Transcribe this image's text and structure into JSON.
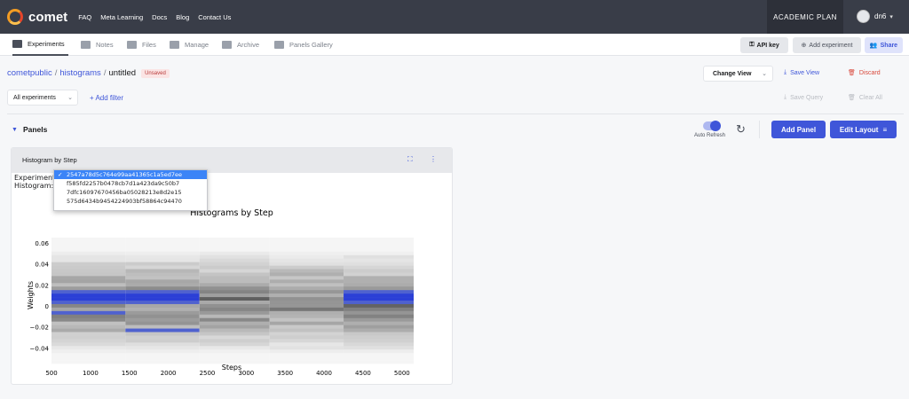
{
  "app": {
    "name": "comet",
    "plan": "ACADEMIC PLAN",
    "user": "dn6"
  },
  "topnav": [
    "FAQ",
    "Meta Learning",
    "Docs",
    "Blog",
    "Contact Us"
  ],
  "tabs": [
    "Experiments",
    "Notes",
    "Files",
    "Manage",
    "Archive",
    "Panels Gallery"
  ],
  "header_buttons": {
    "api_key": "API key",
    "add_experiment": "Add experiment",
    "share": "Share"
  },
  "breadcrumb": {
    "workspace": "cometpublic",
    "project": "histograms",
    "view": "untitled",
    "badge": "Unsaved"
  },
  "view_controls": {
    "change_view": "Change View",
    "save_view": "Save View",
    "discard": "Discard",
    "save_query": "Save Query",
    "clear_all": "Clear All"
  },
  "filters": {
    "experiments_select": "All experiments",
    "add_filter": "+ Add filter"
  },
  "panels": {
    "title": "Panels",
    "auto_refresh": "Auto Refresh",
    "add_panel": "Add Panel",
    "edit_layout": "Edit Layout"
  },
  "card": {
    "title": "Histogram by Step",
    "experiment_label": "Experiment:",
    "histogram_label": "Histogram:",
    "dropdown_options": [
      "2547a78d5c764e99aa41365c1a5ed7ee",
      "f585fd2257b0478cb7d1a423da9c50b7",
      "7dfc16097670456ba05028213e8d2e15",
      "575d6434b9454224903bf58864c94470"
    ],
    "dropdown_selected": 0
  },
  "colors": {
    "accent": "#3f56d9",
    "topbar": "#393d48",
    "danger": "#d9483b"
  },
  "chart_data": {
    "type": "heatmap",
    "title": "Histograms by Step",
    "xlabel": "Steps",
    "ylabel": "Weights",
    "x_ticks": [
      500,
      1000,
      1500,
      2000,
      2500,
      3000,
      3500,
      4000,
      4500,
      5000
    ],
    "y_ticks": [
      0.06,
      0.04,
      0.02,
      0,
      -0.02,
      -0.04
    ],
    "y_tick_labels": [
      "0.06",
      "0.04",
      "0.02",
      "0",
      "−0.02",
      "−0.04"
    ],
    "xlim": [
      500,
      5150
    ],
    "ylim": [
      -0.055,
      0.065
    ],
    "step_columns": [
      {
        "x_start": 500,
        "x_end": 1450
      },
      {
        "x_start": 1450,
        "x_end": 2400
      },
      {
        "x_start": 2400,
        "x_end": 3300
      },
      {
        "x_start": 3300,
        "x_end": 4250
      },
      {
        "x_start": 4250,
        "x_end": 5150
      }
    ]
  }
}
